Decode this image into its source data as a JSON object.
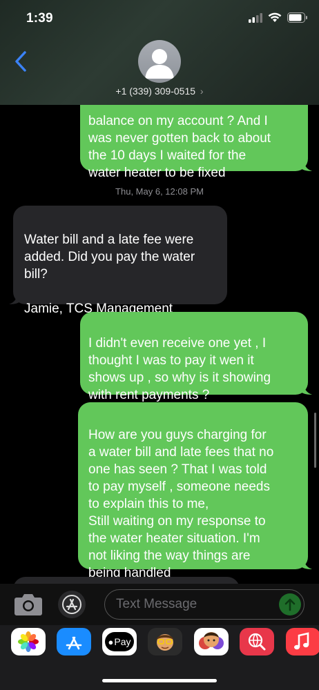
{
  "status": {
    "time": "1:39"
  },
  "header": {
    "contact": "+1 (339) 309-0515",
    "chevron": "›"
  },
  "messages": {
    "m1": "balance on my account ? And I\nwas never gotten back to about\nthe 10 days I waited for the\nwater heater to be fixed",
    "timestamp": "Thu, May 6, 12:08 PM",
    "m2": "Water bill and a late fee were\nadded. Did you pay the water\nbill?\n\nJamie, TCS Management",
    "m3": "I didn't even receive one yet , I\nthought I was to pay it wen it\nshows up , so why is it showing\nwith rent payments ?",
    "m4": "How are you guys charging for\na water bill and late fees that no\none has seen ? That I was told\nto pay myself , someone needs\nto explain this to me,\nStill waiting on my response to\nthe water heater situation. I'm\nnot liking the way things are\nbeing handled"
  },
  "input": {
    "placeholder": "Text Message"
  },
  "tray": {
    "apps": [
      "photos-app",
      "app-store",
      "apple-pay",
      "memoji",
      "animoji",
      "web-search",
      "music"
    ],
    "applepay_label": "Pay"
  },
  "colors": {
    "outgoing": "#62c75a",
    "incoming": "#262629",
    "accent": "#3b82f6"
  }
}
